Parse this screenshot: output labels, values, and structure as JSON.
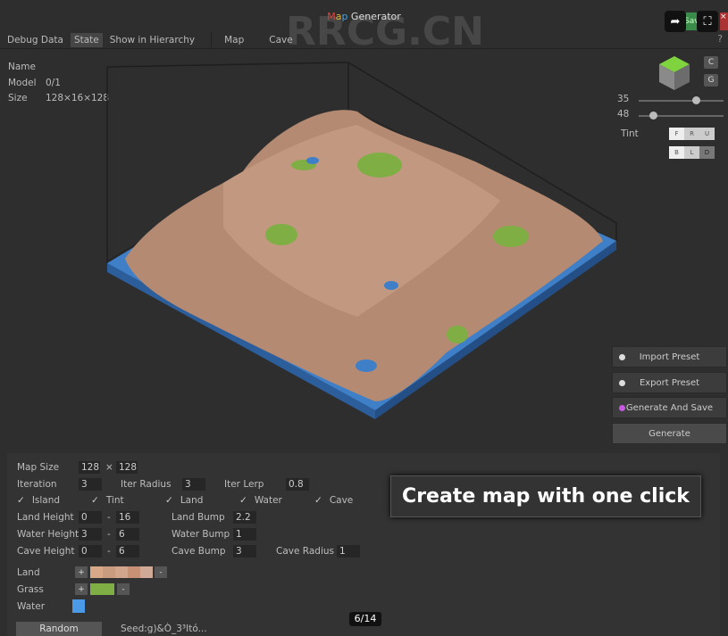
{
  "window": {
    "title_m": "M",
    "title_a": "a",
    "title_p": "p",
    "title_rest": " Generator",
    "save_label": "Save"
  },
  "toolbar": {
    "items": [
      "Debug Data",
      "State",
      "Show in Hierarchy",
      "Map",
      "Cave"
    ],
    "help": "?"
  },
  "info": {
    "name_label": "Name",
    "model_label": "Model",
    "model_value": "0/1",
    "size_label": "Size",
    "size_value": "128×16×128"
  },
  "view": {
    "c_button": "C",
    "g_button": "G",
    "slider1": 35,
    "slider2": 48,
    "tint_label": "Tint",
    "tint_top": [
      "F",
      "R",
      "U"
    ],
    "tint_bottom": [
      "B",
      "L",
      "D"
    ]
  },
  "actions": {
    "import": "Import Preset",
    "export": "Export Preset",
    "generate_save": "Generate And Save",
    "generate": "Generate"
  },
  "settings": {
    "map_size_label": "Map Size",
    "map_w": "128",
    "x": "×",
    "map_h": "128",
    "iteration_label": "Iteration",
    "iteration": "3",
    "iter_radius_label": "Iter Radius",
    "iter_radius": "3",
    "iter_lerp_label": "Iter Lerp",
    "iter_lerp": "0.8",
    "checks": [
      "Island",
      "Tint",
      "Land",
      "Water",
      "Cave"
    ],
    "land_height_label": "Land Height",
    "land_min": "0",
    "land_max": "16",
    "land_bump_label": "Land Bump",
    "land_bump": "2.2",
    "water_height_label": "Water Height",
    "water_min": "3",
    "water_max": "6",
    "water_bump_label": "Water Bump",
    "water_bump": "1",
    "cave_height_label": "Cave Height",
    "cave_min": "0",
    "cave_max": "6",
    "cave_bump_label": "Cave Bump",
    "cave_bump": "3",
    "cave_radius_label": "Cave Radius",
    "cave_radius": "1",
    "dash": "-",
    "plus": "+",
    "minus": "-",
    "land_label": "Land",
    "grass_label": "Grass",
    "water_label": "Water",
    "land_colors": [
      "#d8a888",
      "#c99c80",
      "#d2a68c",
      "#c89074",
      "#d0aa96"
    ],
    "grass_color": "#7fae45",
    "water_color": "#4a9ae8",
    "random": "Random",
    "seed": "Seed:g)&Ò_3³Itó..."
  },
  "caption": "Create map with one click",
  "pager": "6/14",
  "watermark": "RRCG.CN"
}
